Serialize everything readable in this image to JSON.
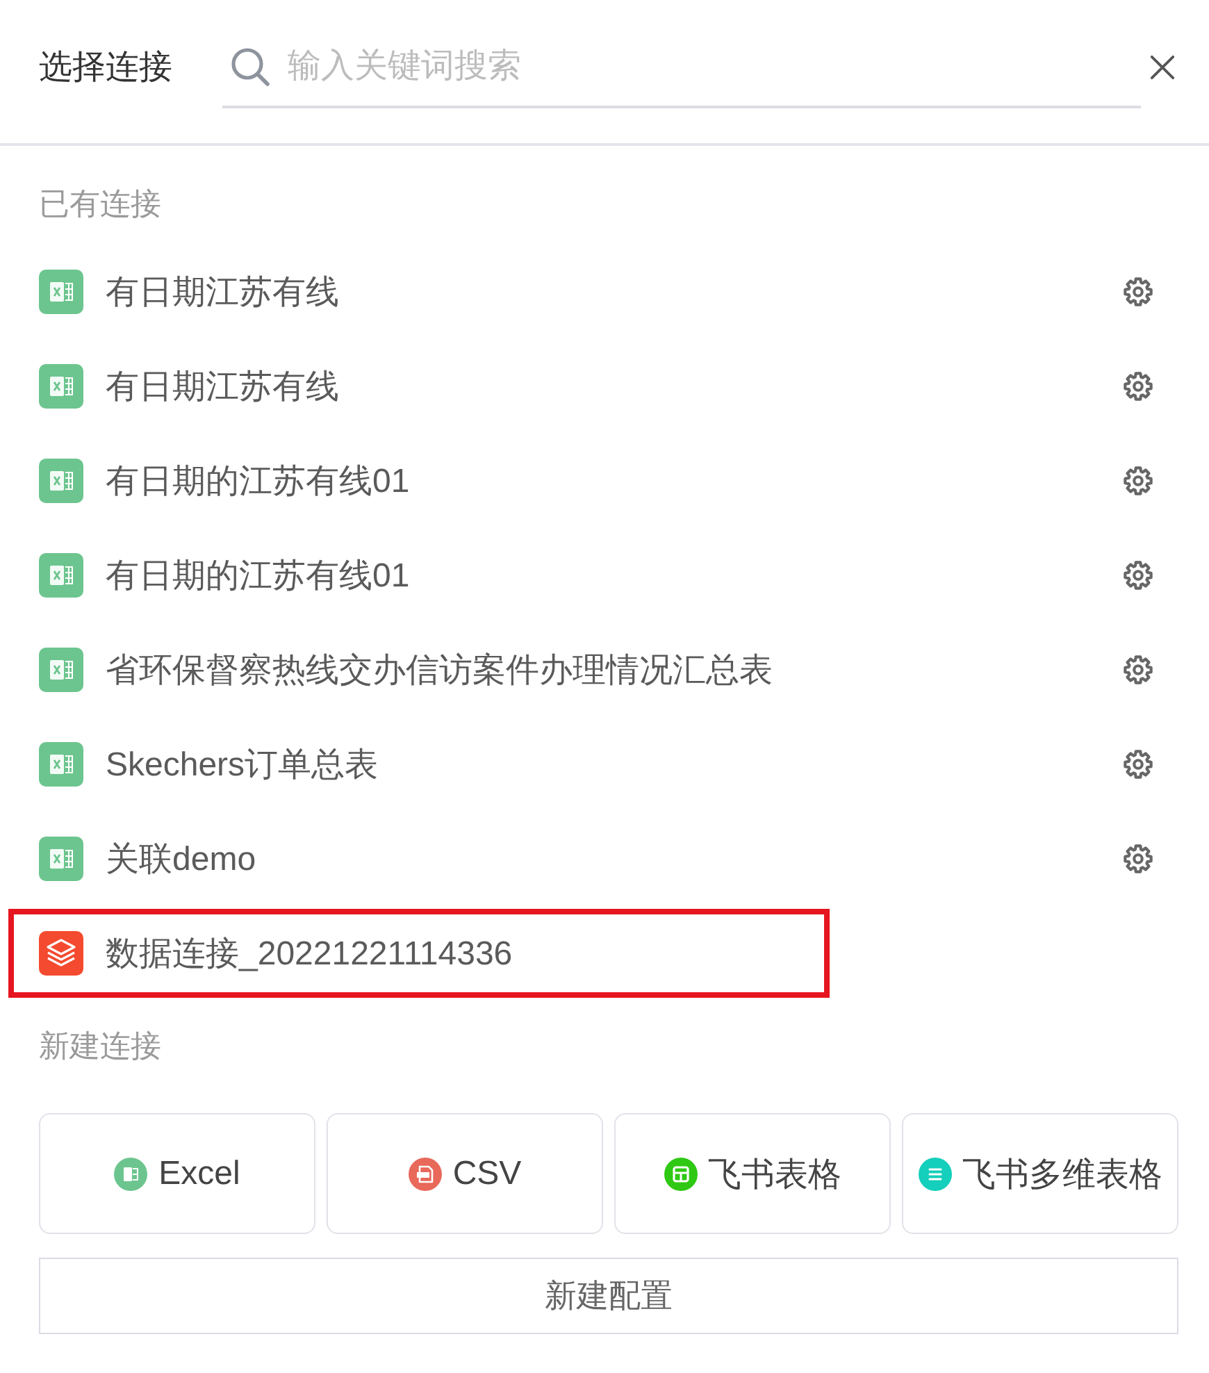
{
  "header": {
    "title": "选择连接",
    "search": {
      "placeholder": "输入关键词搜索"
    }
  },
  "existing": {
    "heading": "已有连接",
    "items": [
      {
        "name": "有日期江苏有线",
        "kind": "excel",
        "settings": true,
        "highlighted": false
      },
      {
        "name": "有日期江苏有线",
        "kind": "excel",
        "settings": true,
        "highlighted": false
      },
      {
        "name": "有日期的江苏有线01",
        "kind": "excel",
        "settings": true,
        "highlighted": false
      },
      {
        "name": "有日期的江苏有线01",
        "kind": "excel",
        "settings": true,
        "highlighted": false
      },
      {
        "name": "省环保督察热线交办信访案件办理情况汇总表",
        "kind": "excel",
        "settings": true,
        "highlighted": false
      },
      {
        "name": "Skechers订单总表",
        "kind": "excel",
        "settings": true,
        "highlighted": false
      },
      {
        "name": "关联demo",
        "kind": "excel",
        "settings": true,
        "highlighted": false
      },
      {
        "name": "数据连接_20221221114336",
        "kind": "datasource",
        "settings": false,
        "highlighted": true
      }
    ]
  },
  "create": {
    "heading": "新建连接",
    "sources": [
      {
        "label": "Excel",
        "kind": "excel"
      },
      {
        "label": "CSV",
        "kind": "csv"
      },
      {
        "label": "飞书表格",
        "kind": "sheet"
      },
      {
        "label": "飞书多维表格",
        "kind": "bitable"
      }
    ],
    "config_button": "新建配置"
  }
}
